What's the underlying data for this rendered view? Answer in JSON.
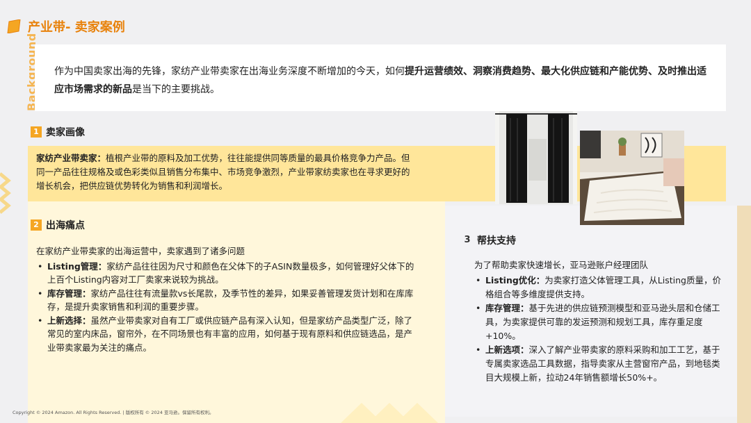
{
  "header": {
    "title": "产业带- 卖家案例",
    "side_label": "Background"
  },
  "intro": {
    "plain_1": "作为中国卖家出海的先锋，家纺产业带卖家在出海业务深度不断增加的今天，如何",
    "bold_1": "提升运营绩效、洞察消费趋势、最大化供应链和产能优势、及时推出适应市场需求的新品",
    "plain_2": "是当下的主要挑战。"
  },
  "sections": {
    "profile": {
      "number": "1",
      "heading": "卖家画像",
      "lead": "家纺产业带卖家：",
      "body": "植根产业带的原料及加工优势，往往能提供同等质量的最具价格竞争力产品。但同一产品往往规格及或色彩类似且销售分布集中、市场竞争激烈，产业带家纺卖家也在寻求更好的增长机会，把供应链优势转化为销售和利润增长。"
    },
    "pain": {
      "number": "2",
      "heading": "出海痛点",
      "intro": "在家纺产业带卖家的出海运营中，卖家遇到了诸多问题",
      "items": [
        {
          "label": "Listing管理：",
          "text": "家纺产品往往因为尺寸和颜色在父体下的子ASIN数量极多，如何管理好父体下的上百个Listing内容对工厂卖家来说较为挑战。"
        },
        {
          "label": "库存管理：",
          "text": "家纺产品往往有流量款vs长尾款，及季节性的差异，如果妥善管理发货计划和在库库存，是提升卖家销售和利润的重要步骤。"
        },
        {
          "label": "上新选择：",
          "text": "虽然产业带卖家对自有工厂或供应链产品有深入认知，但是家纺产品类型广泛，除了常见的室内床品，窗帘外，在不同场景也有丰富的应用，如何基于现有原料和供应链选品，是产业带卖家最为关注的痛点。"
        }
      ]
    },
    "support": {
      "number": "3",
      "heading": "帮扶支持",
      "intro": "为了帮助卖家快速增长，亚马逊账户经理团队",
      "items": [
        {
          "label": "Listing优化：",
          "text": "为卖家打造父体管理工具，从Listing质量，价格组合等多维度提供支持。"
        },
        {
          "label": "库存管理：",
          "text": "基于先进的供应链预测模型和亚马逊头层和仓储工具，为卖家提供可靠的发运预测和规划工具，库存重足度+10%。"
        },
        {
          "label": "上新选项：",
          "text": "深入了解产业带卖家的原料采购和加工工艺，基于专属卖家选品工具数据，指导卖家从主营窗帘产品，到地毯类目大规模上新，拉动24年销售额增长50%+。"
        }
      ]
    }
  },
  "images": {
    "curtain": "curtain-photo",
    "rug": "rug-photo"
  },
  "footer": {
    "copyright": "Copyright © 2024 Amazon. All Rights Reserved. | 版权所有 © 2024 亚马逊。保留所有权利。"
  },
  "colors": {
    "accent": "#e8820c",
    "number_badge": "#f5a623",
    "band": "#ffe69a",
    "pale": "#fff7db"
  }
}
